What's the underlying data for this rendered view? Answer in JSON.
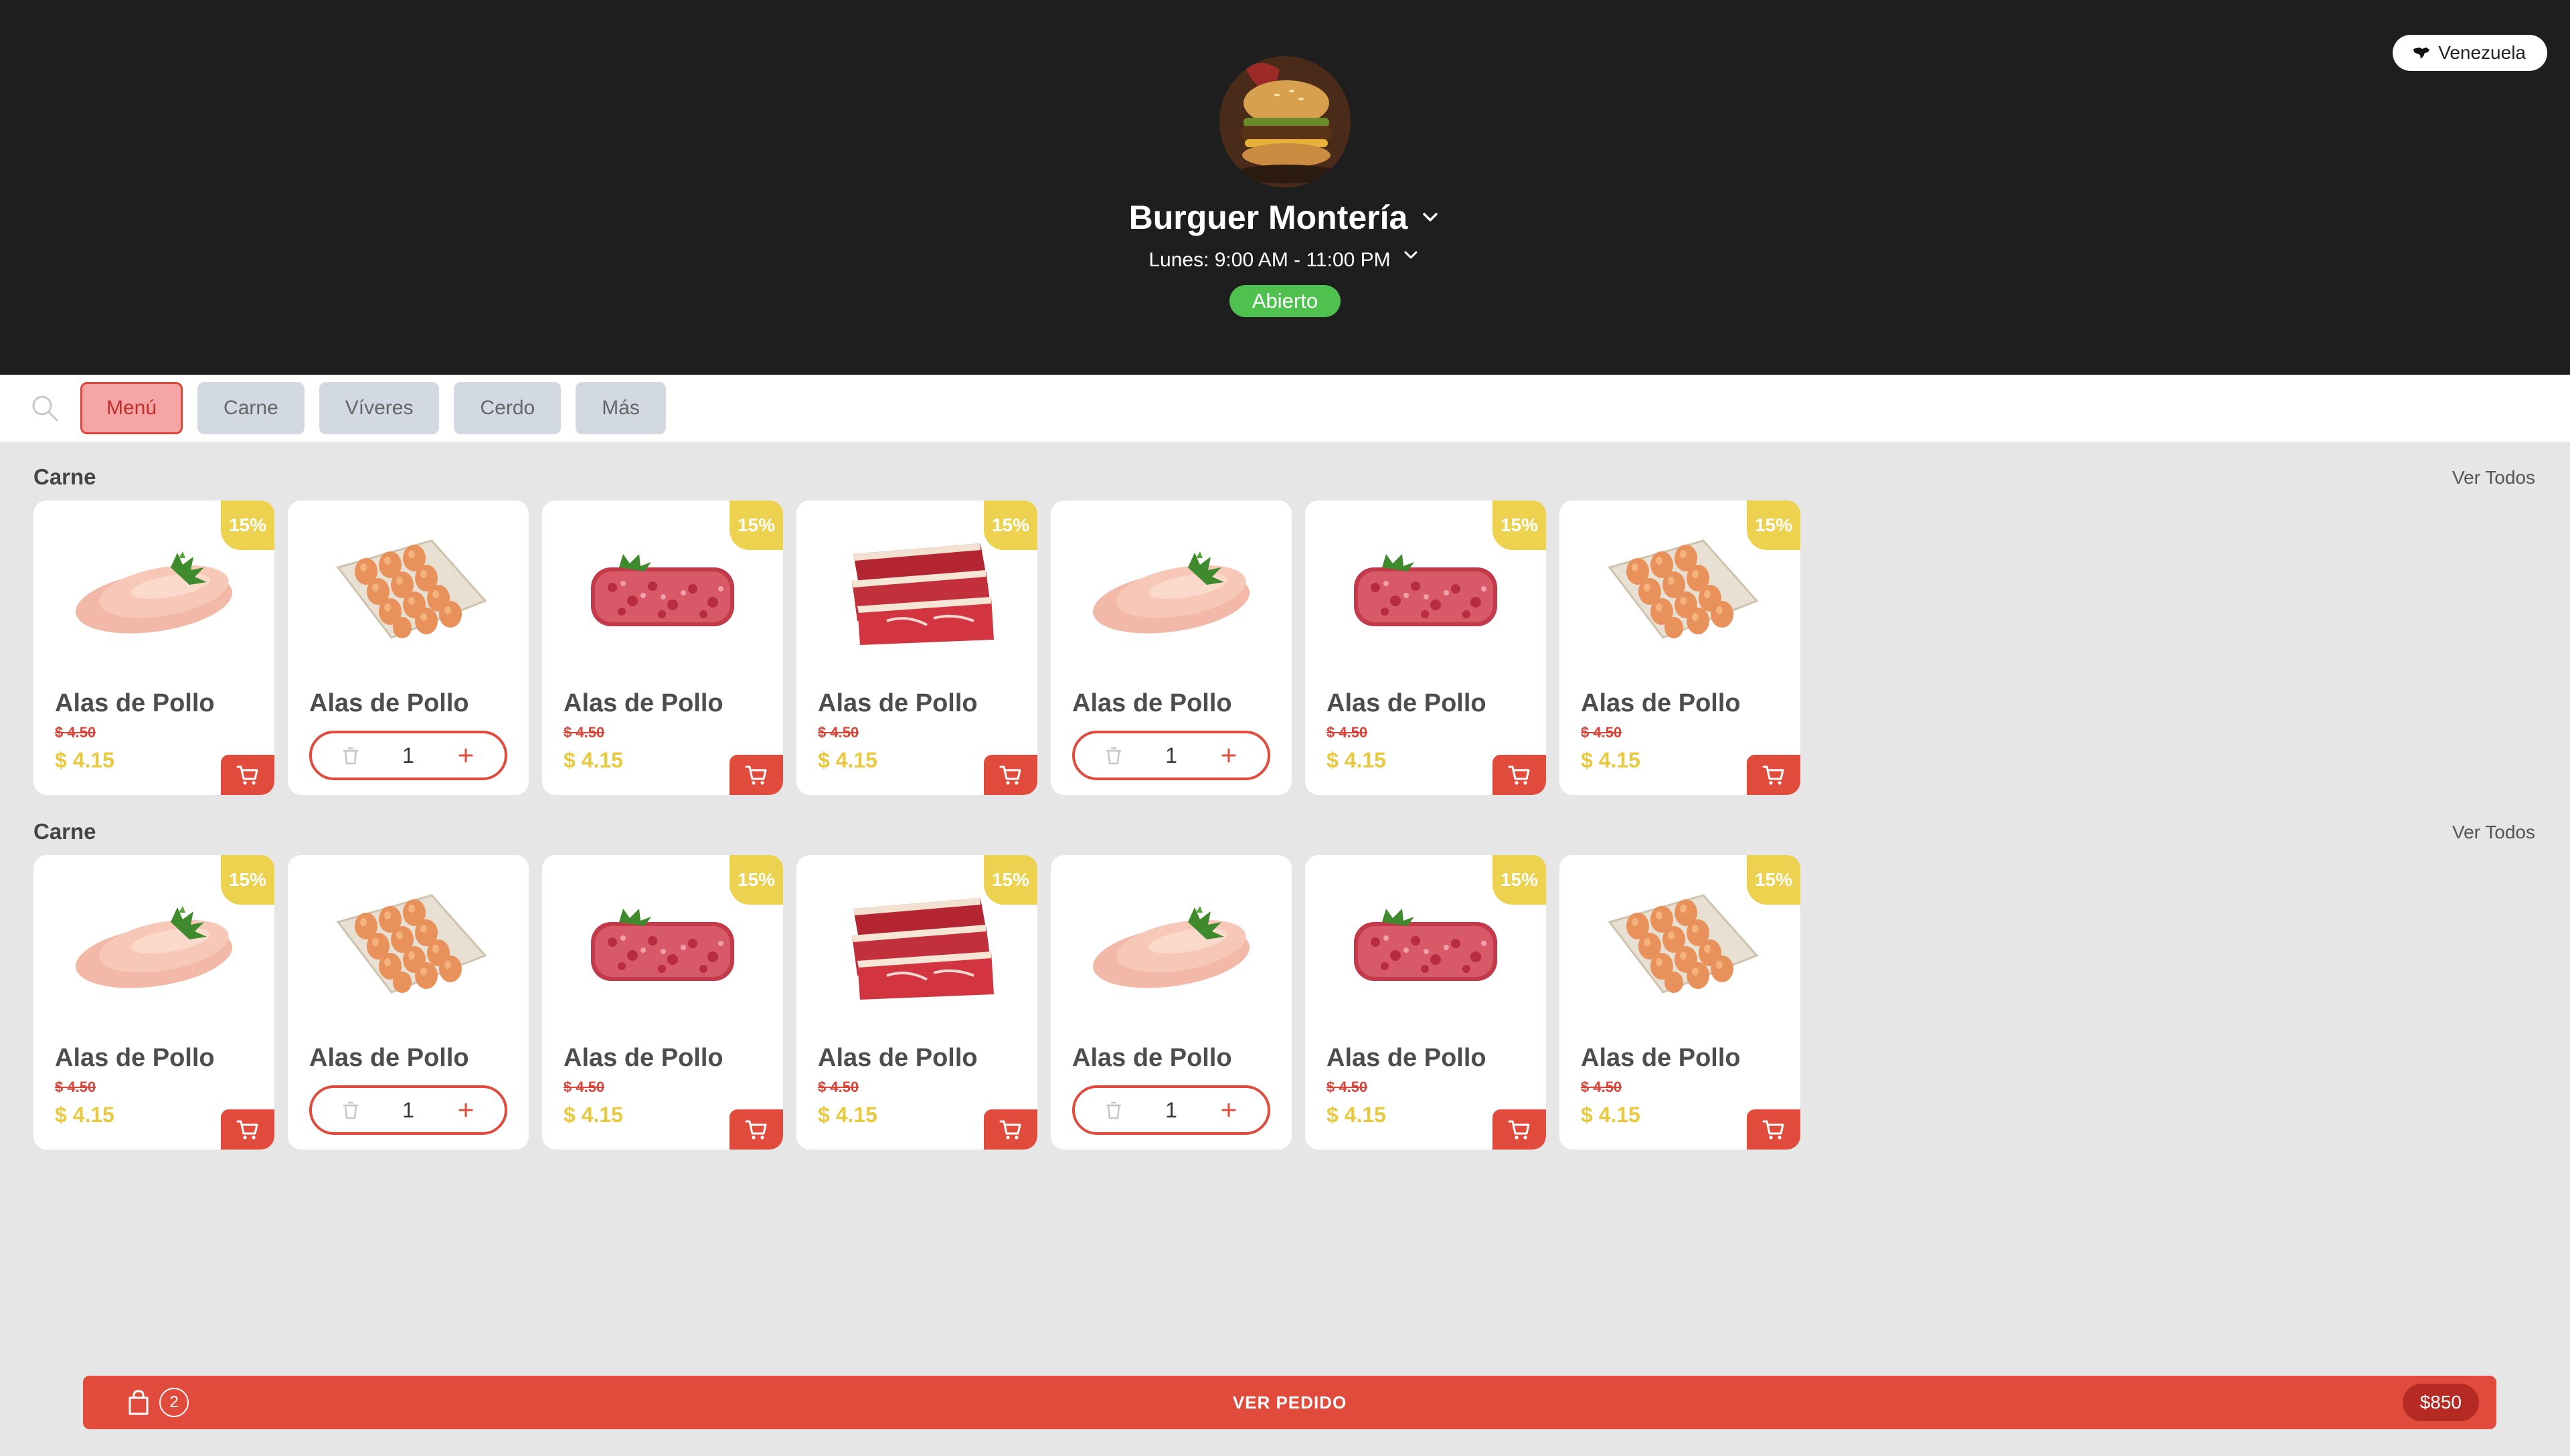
{
  "header": {
    "country": "Venezuela",
    "store_name": "Burguer Montería",
    "hours": "Lunes: 9:00 AM - 11:00 PM",
    "status": "Abierto"
  },
  "categories": [
    "Menú",
    "Carne",
    "Víveres",
    "Cerdo",
    "Más"
  ],
  "sections": [
    {
      "title": "Carne",
      "see_all": "Ver Todos",
      "items": [
        {
          "name": "Alas de Pollo",
          "image": "chicken-breast",
          "discount": "15%",
          "old_price": "$ 4.50",
          "price": "$ 4.15",
          "in_cart": false
        },
        {
          "name": "Alas de Pollo",
          "image": "eggs",
          "discount": "",
          "old_price": "",
          "price": "",
          "in_cart": true,
          "qty": "1"
        },
        {
          "name": "Alas de Pollo",
          "image": "ground-beef",
          "discount": "15%",
          "old_price": "$ 4.50",
          "price": "$ 4.15",
          "in_cart": false
        },
        {
          "name": "Alas de Pollo",
          "image": "beef-steak",
          "discount": "15%",
          "old_price": "$ 4.50",
          "price": "$ 4.15",
          "in_cart": false
        },
        {
          "name": "Alas de Pollo",
          "image": "chicken-breast",
          "discount": "",
          "old_price": "",
          "price": "",
          "in_cart": true,
          "qty": "1"
        },
        {
          "name": "Alas de Pollo",
          "image": "ground-beef",
          "discount": "15%",
          "old_price": "$ 4.50",
          "price": "$ 4.15",
          "in_cart": false
        },
        {
          "name": "Alas de Pollo",
          "image": "eggs",
          "discount": "15%",
          "old_price": "$ 4.50",
          "price": "$ 4.15",
          "in_cart": false
        }
      ]
    },
    {
      "title": "Carne",
      "see_all": "Ver Todos",
      "items": [
        {
          "name": "Alas de Pollo",
          "image": "chicken-breast",
          "discount": "15%",
          "old_price": "$ 4.50",
          "price": "$ 4.15",
          "in_cart": false
        },
        {
          "name": "Alas de Pollo",
          "image": "eggs",
          "discount": "",
          "old_price": "",
          "price": "",
          "in_cart": true,
          "qty": "1"
        },
        {
          "name": "Alas de Pollo",
          "image": "ground-beef",
          "discount": "15%",
          "old_price": "$ 4.50",
          "price": "$ 4.15",
          "in_cart": false
        },
        {
          "name": "Alas de Pollo",
          "image": "beef-steak",
          "discount": "15%",
          "old_price": "$ 4.50",
          "price": "$ 4.15",
          "in_cart": false
        },
        {
          "name": "Alas de Pollo",
          "image": "chicken-breast",
          "discount": "",
          "old_price": "",
          "price": "",
          "in_cart": true,
          "qty": "1"
        },
        {
          "name": "Alas de Pollo",
          "image": "ground-beef",
          "discount": "15%",
          "old_price": "$ 4.50",
          "price": "$ 4.15",
          "in_cart": false
        },
        {
          "name": "Alas de Pollo",
          "image": "eggs",
          "discount": "15%",
          "old_price": "$ 4.50",
          "price": "$ 4.15",
          "in_cart": false
        }
      ]
    }
  ],
  "order_bar": {
    "item_count": "2",
    "label": "VER PEDIDO",
    "total": "$850"
  },
  "colors": {
    "header_bg": "#1e1e1e",
    "accent_red": "#e04b3c",
    "discount_yellow": "#ecd24e",
    "open_green": "#4ec14f"
  }
}
